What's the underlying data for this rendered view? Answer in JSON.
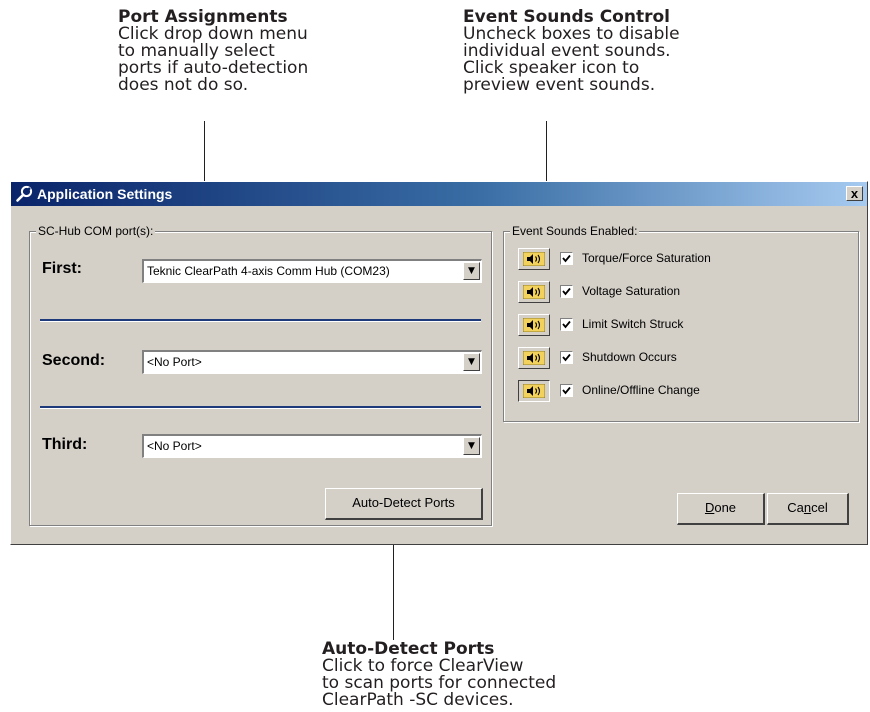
{
  "callouts": {
    "port_assignments": {
      "title": "Port Assignments",
      "body": "Click drop down menu\nto manually select\nports if auto-detection\ndoes not do so."
    },
    "event_sounds": {
      "title": "Event Sounds Control",
      "body": "Uncheck boxes to disable\nindividual event sounds.\nClick speaker icon to\npreview event sounds."
    },
    "auto_detect": {
      "title": "Auto-Detect Ports",
      "body": "Click to force ClearView\nto scan ports for connected\nClearPath -SC devices."
    }
  },
  "window": {
    "title": "Application Settings",
    "close_label": "x",
    "title_icon": "wrench-icon",
    "title_bar_color": "#0a246a",
    "face_color": "#d4d0c8"
  },
  "com_ports": {
    "legend": "SC-Hub COM port(s):",
    "first": {
      "label": "First:",
      "value": "Teknic ClearPath 4-axis Comm Hub (COM23)"
    },
    "second": {
      "label": "Second:",
      "value": "<No Port>"
    },
    "third": {
      "label": "Third:",
      "value": "<No Port>"
    },
    "auto_detect_label": "Auto-Detect Ports"
  },
  "event_sounds": {
    "legend": "Event Sounds Enabled:",
    "items": [
      {
        "label": "Torque/Force Saturation",
        "checked": true
      },
      {
        "label": "Voltage Saturation",
        "checked": true
      },
      {
        "label": "Limit Switch Struck",
        "checked": true
      },
      {
        "label": "Shutdown Occurs",
        "checked": true
      },
      {
        "label": "Online/Offline Change",
        "checked": true
      }
    ]
  },
  "buttons": {
    "done": {
      "pre": "",
      "accel": "D",
      "post": "one"
    },
    "cancel": {
      "pre": "Ca",
      "accel": "n",
      "post": "cel"
    }
  }
}
